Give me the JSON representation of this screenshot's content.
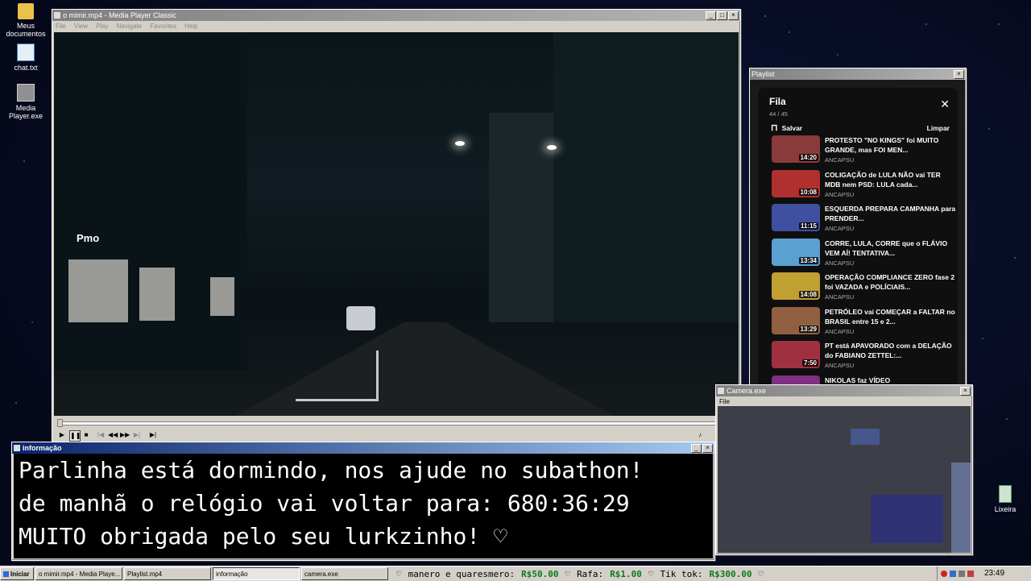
{
  "desktop": {
    "icons": [
      {
        "label": "Meus documentos"
      },
      {
        "label": "chat.txt"
      },
      {
        "label": "Media Player.exe"
      },
      {
        "label": "Lixeira"
      }
    ]
  },
  "mpc": {
    "title": "o mimir.mp4 - Media Player Classic",
    "menu": [
      "File",
      "View",
      "Play",
      "Navigate",
      "Favorites",
      "Help"
    ],
    "video_signs": [
      "Pmo"
    ]
  },
  "info": {
    "title": "informação",
    "lines": [
      "Parlinha está dormindo, nos ajude no subathon!",
      "de manhã o relógio vai voltar para:  680:36:29",
      "MUITO obrigada pelo seu lurkzinho! ♡"
    ]
  },
  "playlist": {
    "title": "Playlist",
    "queue_title": "Fila",
    "count": "44 / 45",
    "save_label": "Salvar",
    "clear_label": "Limpar",
    "items": [
      {
        "title": "PROTESTO \"NO KINGS\" foi MUITO GRANDE, mas FOI MEN...",
        "channel": "ANCAPSU",
        "duration": "14:20",
        "color": "#8a3a3a"
      },
      {
        "title": "COLIGAÇÃO de LULA NÃO vai TER MDB nem PSD: LULA cada...",
        "channel": "ANCAPSU",
        "duration": "10:08",
        "color": "#b03030"
      },
      {
        "title": "ESQUERDA PREPARA CAMPANHA para PRENDER...",
        "channel": "ANCAPSU",
        "duration": "11:15",
        "color": "#4050a0"
      },
      {
        "title": "CORRE, LULA, CORRE que o FLÁVIO VEM AÍ! TENTATIVA...",
        "channel": "ANCAPSU",
        "duration": "13:34",
        "color": "#5aa0d0"
      },
      {
        "title": "OPERAÇÃO COMPLIANCE ZERO fase 2 foi VAZADA e POLÍCIAIS...",
        "channel": "ANCAPSU",
        "duration": "14:08",
        "color": "#c0a030"
      },
      {
        "title": "PETRÓLEO vai COMEÇAR a FALTAR no BRASIL entre 15 e 2...",
        "channel": "ANCAPSU",
        "duration": "13:29",
        "color": "#906040"
      },
      {
        "title": "PT está APAVORADO com a DELAÇÃO do FABIANO ZETTEL:...",
        "channel": "ANCAPSU",
        "duration": "7:50",
        "color": "#a03040"
      },
      {
        "title": "NIKOLAS faz VÍDEO",
        "channel": "",
        "duration": "",
        "color": "#803080"
      }
    ]
  },
  "camera": {
    "title": "Camera.exe",
    "menu": [
      "File"
    ]
  },
  "taskbar": {
    "start_label": "Iniciar",
    "tasks": [
      "o mimir.mp4 - Media Playe...",
      "Playlist.mp4",
      "informação",
      "camera.exe"
    ],
    "ticker": [
      {
        "name": "manero e quaresmero:",
        "amount": "R$50.00"
      },
      {
        "name": "Rafa:",
        "amount": "R$1.00"
      },
      {
        "name": "Tik tok:",
        "amount": "R$300.00"
      }
    ],
    "clock": "23:49"
  }
}
